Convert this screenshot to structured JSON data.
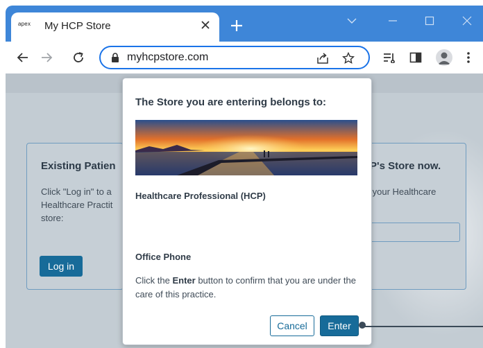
{
  "browser": {
    "tab": {
      "favicon_text": "apex",
      "title": "My HCP Store"
    },
    "address_bar": {
      "url": "myhcpstore.com"
    },
    "colors": {
      "titlebar": "#3e86d8",
      "focus_ring": "#1a73e8"
    }
  },
  "background_page": {
    "left_card": {
      "heading": "Existing Patien",
      "text": "Click \"Log in\" to a\nHealthcare Practit\nstore:",
      "login_label": "Log in"
    },
    "right_card": {
      "heading": "P's Store now.",
      "text": " your Healthcare"
    }
  },
  "modal": {
    "title": "The Store you are entering belongs to:",
    "practice_name": "Healthcare Professional (HCP)",
    "office_phone_label": "Office Phone",
    "confirm_text": {
      "before": "Click the ",
      "bold": "Enter",
      "after": " button to confirm that you are under the care of this practice."
    },
    "cancel_label": "Cancel",
    "enter_label": "Enter",
    "colors": {
      "primary": "#176b99"
    }
  }
}
